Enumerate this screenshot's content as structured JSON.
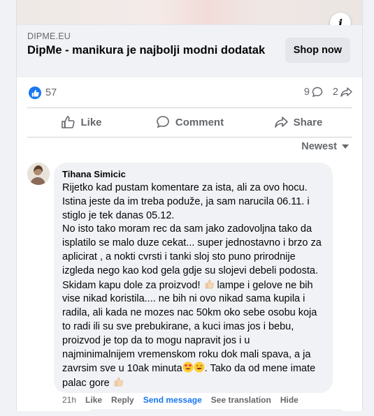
{
  "link_preview": {
    "domain": "DIPME.EU",
    "headline": "DipMe - manikura je najbolji modni dodatak",
    "cta_label": "Shop now",
    "info_glyph": "i"
  },
  "reactions": {
    "like_count": "57",
    "comment_count": "9",
    "share_count": "2"
  },
  "actions": {
    "like_label": "Like",
    "comment_label": "Comment",
    "share_label": "Share"
  },
  "sort": {
    "label": "Newest"
  },
  "comment": {
    "author": "Tihana Simicic",
    "text_part1": "Rijetko kad pustam komentare za ista, ali za ovo hocu.\nIstina jeste da im treba poduže, ja sam narucila 06.11. i stiglo je tek danas 05.12.\nNo isto tako moram rec da sam jako zadovoljna tako da isplatilo se malo duze cekat... super jednostavno i brzo za aplicirat , a nokti cvrsti i tanki sloj sto puno prirodnije izgleda nego kao kod gela gdje su slojevi debeli podosta. Skidam kapu dole za proizvod! ",
    "text_part2": " lampe i gelove ne bih vise nikad koristila.... ne bih ni ovo nikad sama kupila i radila, ali kada ne mozes nac 50km oko sebe osobu koja to radi ili su sve prebukirane, a kuci imas jos i bebu, proizvod je top da to mogu napravit jos i u najminimalnijem vremenskom roku dok mali spava, a ja zavrsim sve u 10ak minuta",
    "text_part3": ". Tako da od mene imate palac gore ",
    "time": "21h",
    "like_label": "Like",
    "reply_label": "Reply",
    "send_message_label": "Send message",
    "see_translation_label": "See translation",
    "hide_label": "Hide"
  },
  "colors": {
    "accent": "#1877f2",
    "secondary_text": "#65676b",
    "bubble_bg": "#f0f2f5"
  }
}
